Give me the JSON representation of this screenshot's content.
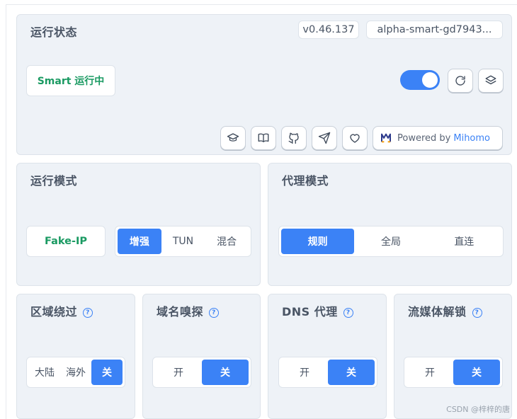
{
  "status": {
    "title": "运行状态",
    "version": "v0.46.137",
    "build": "alpha-smart-gd7943...",
    "running_label": "Smart 运行中",
    "toggle_on": true,
    "powered_by": "Powered by",
    "powered_brand": "Mihomo",
    "icons": [
      "refresh-icon",
      "layers-icon",
      "graduation-cap-icon",
      "book-icon",
      "github-icon",
      "send-icon",
      "heart-icon"
    ]
  },
  "run_mode": {
    "title": "运行模式",
    "current": "Fake-IP",
    "options": [
      "增强",
      "TUN",
      "混合"
    ],
    "selected": "增强"
  },
  "proxy_mode": {
    "title": "代理模式",
    "options": [
      "规则",
      "全局",
      "直连"
    ],
    "selected": "规则"
  },
  "region_bypass": {
    "title": "区域绕过",
    "help": "?",
    "options": [
      "大陆",
      "海外",
      "关"
    ],
    "selected": "关"
  },
  "domain_sniff": {
    "title": "域名嗅探",
    "help": "?",
    "options": [
      "开",
      "关"
    ],
    "selected": "关"
  },
  "dns_proxy": {
    "title": "DNS 代理",
    "help": "?",
    "options": [
      "开",
      "关"
    ],
    "selected": "关"
  },
  "media_unlock": {
    "title": "流媒体解锁",
    "help": "?",
    "options": [
      "开",
      "关"
    ],
    "selected": "关"
  },
  "watermark": "CSDN @梓梓的唐",
  "colors": {
    "accent": "#3b82f6",
    "running": "#1a9a62",
    "card_bg": "#eef2f7"
  }
}
